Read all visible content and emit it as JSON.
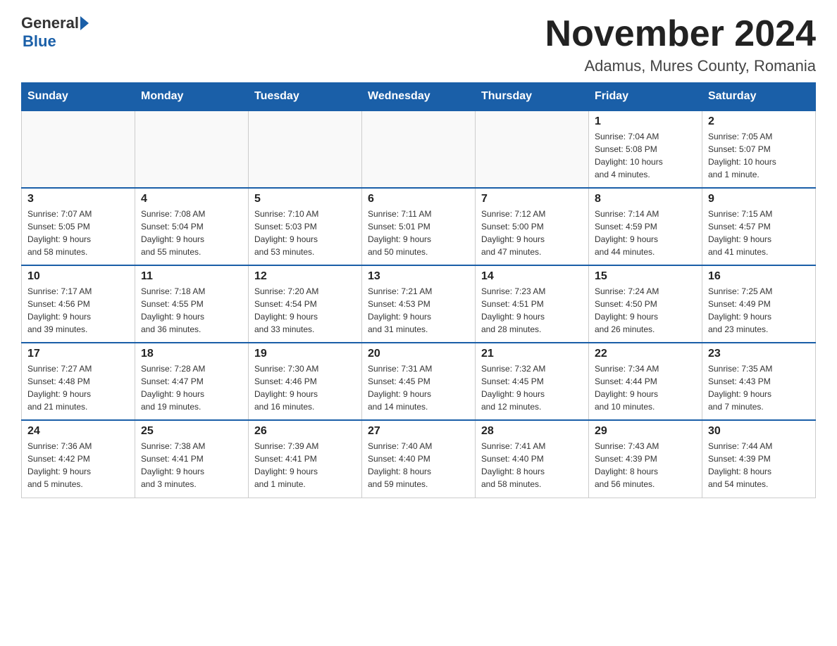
{
  "header": {
    "logo_general": "General",
    "logo_blue": "Blue",
    "month_title": "November 2024",
    "location": "Adamus, Mures County, Romania"
  },
  "weekdays": [
    "Sunday",
    "Monday",
    "Tuesday",
    "Wednesday",
    "Thursday",
    "Friday",
    "Saturday"
  ],
  "weeks": [
    [
      {
        "day": "",
        "info": ""
      },
      {
        "day": "",
        "info": ""
      },
      {
        "day": "",
        "info": ""
      },
      {
        "day": "",
        "info": ""
      },
      {
        "day": "",
        "info": ""
      },
      {
        "day": "1",
        "info": "Sunrise: 7:04 AM\nSunset: 5:08 PM\nDaylight: 10 hours\nand 4 minutes."
      },
      {
        "day": "2",
        "info": "Sunrise: 7:05 AM\nSunset: 5:07 PM\nDaylight: 10 hours\nand 1 minute."
      }
    ],
    [
      {
        "day": "3",
        "info": "Sunrise: 7:07 AM\nSunset: 5:05 PM\nDaylight: 9 hours\nand 58 minutes."
      },
      {
        "day": "4",
        "info": "Sunrise: 7:08 AM\nSunset: 5:04 PM\nDaylight: 9 hours\nand 55 minutes."
      },
      {
        "day": "5",
        "info": "Sunrise: 7:10 AM\nSunset: 5:03 PM\nDaylight: 9 hours\nand 53 minutes."
      },
      {
        "day": "6",
        "info": "Sunrise: 7:11 AM\nSunset: 5:01 PM\nDaylight: 9 hours\nand 50 minutes."
      },
      {
        "day": "7",
        "info": "Sunrise: 7:12 AM\nSunset: 5:00 PM\nDaylight: 9 hours\nand 47 minutes."
      },
      {
        "day": "8",
        "info": "Sunrise: 7:14 AM\nSunset: 4:59 PM\nDaylight: 9 hours\nand 44 minutes."
      },
      {
        "day": "9",
        "info": "Sunrise: 7:15 AM\nSunset: 4:57 PM\nDaylight: 9 hours\nand 41 minutes."
      }
    ],
    [
      {
        "day": "10",
        "info": "Sunrise: 7:17 AM\nSunset: 4:56 PM\nDaylight: 9 hours\nand 39 minutes."
      },
      {
        "day": "11",
        "info": "Sunrise: 7:18 AM\nSunset: 4:55 PM\nDaylight: 9 hours\nand 36 minutes."
      },
      {
        "day": "12",
        "info": "Sunrise: 7:20 AM\nSunset: 4:54 PM\nDaylight: 9 hours\nand 33 minutes."
      },
      {
        "day": "13",
        "info": "Sunrise: 7:21 AM\nSunset: 4:53 PM\nDaylight: 9 hours\nand 31 minutes."
      },
      {
        "day": "14",
        "info": "Sunrise: 7:23 AM\nSunset: 4:51 PM\nDaylight: 9 hours\nand 28 minutes."
      },
      {
        "day": "15",
        "info": "Sunrise: 7:24 AM\nSunset: 4:50 PM\nDaylight: 9 hours\nand 26 minutes."
      },
      {
        "day": "16",
        "info": "Sunrise: 7:25 AM\nSunset: 4:49 PM\nDaylight: 9 hours\nand 23 minutes."
      }
    ],
    [
      {
        "day": "17",
        "info": "Sunrise: 7:27 AM\nSunset: 4:48 PM\nDaylight: 9 hours\nand 21 minutes."
      },
      {
        "day": "18",
        "info": "Sunrise: 7:28 AM\nSunset: 4:47 PM\nDaylight: 9 hours\nand 19 minutes."
      },
      {
        "day": "19",
        "info": "Sunrise: 7:30 AM\nSunset: 4:46 PM\nDaylight: 9 hours\nand 16 minutes."
      },
      {
        "day": "20",
        "info": "Sunrise: 7:31 AM\nSunset: 4:45 PM\nDaylight: 9 hours\nand 14 minutes."
      },
      {
        "day": "21",
        "info": "Sunrise: 7:32 AM\nSunset: 4:45 PM\nDaylight: 9 hours\nand 12 minutes."
      },
      {
        "day": "22",
        "info": "Sunrise: 7:34 AM\nSunset: 4:44 PM\nDaylight: 9 hours\nand 10 minutes."
      },
      {
        "day": "23",
        "info": "Sunrise: 7:35 AM\nSunset: 4:43 PM\nDaylight: 9 hours\nand 7 minutes."
      }
    ],
    [
      {
        "day": "24",
        "info": "Sunrise: 7:36 AM\nSunset: 4:42 PM\nDaylight: 9 hours\nand 5 minutes."
      },
      {
        "day": "25",
        "info": "Sunrise: 7:38 AM\nSunset: 4:41 PM\nDaylight: 9 hours\nand 3 minutes."
      },
      {
        "day": "26",
        "info": "Sunrise: 7:39 AM\nSunset: 4:41 PM\nDaylight: 9 hours\nand 1 minute."
      },
      {
        "day": "27",
        "info": "Sunrise: 7:40 AM\nSunset: 4:40 PM\nDaylight: 8 hours\nand 59 minutes."
      },
      {
        "day": "28",
        "info": "Sunrise: 7:41 AM\nSunset: 4:40 PM\nDaylight: 8 hours\nand 58 minutes."
      },
      {
        "day": "29",
        "info": "Sunrise: 7:43 AM\nSunset: 4:39 PM\nDaylight: 8 hours\nand 56 minutes."
      },
      {
        "day": "30",
        "info": "Sunrise: 7:44 AM\nSunset: 4:39 PM\nDaylight: 8 hours\nand 54 minutes."
      }
    ]
  ]
}
